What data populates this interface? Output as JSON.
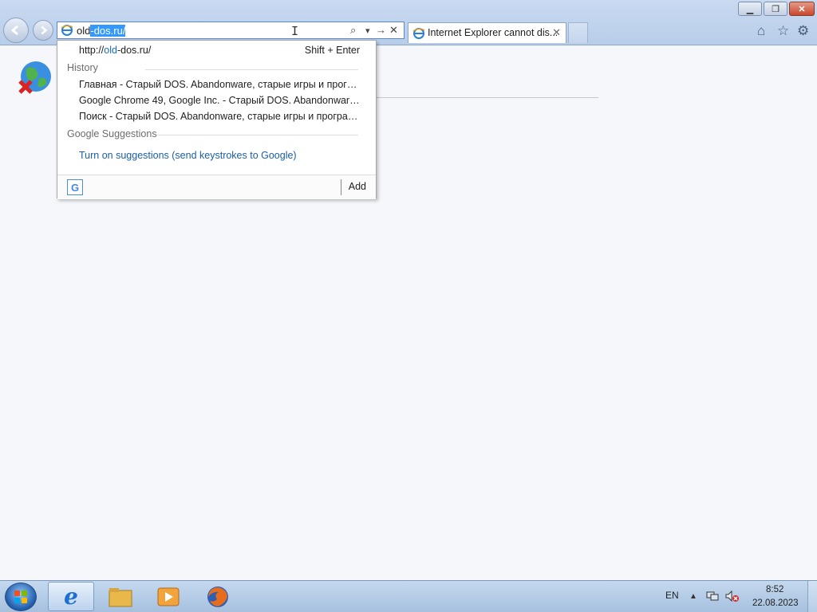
{
  "colors": {
    "accent": "#3399ff",
    "link": "#1a5fa8",
    "close_red": "#c9462b"
  },
  "window": {
    "minimize_glyph": "▁",
    "maximize_glyph": "❐",
    "close_glyph": "✕"
  },
  "address_bar": {
    "value_typed": "old",
    "value_autocomplete": "-dos.ru/",
    "search_glyph": "⌕",
    "dropdown_glyph": "▾",
    "go_glyph": "→",
    "stop_glyph": "✕"
  },
  "tab": {
    "title": "Internet Explorer cannot dis...",
    "close_glyph": "✕"
  },
  "toolbar": {
    "home_glyph": "⌂",
    "favorites_glyph": "☆",
    "tools_glyph": "⚙"
  },
  "dropdown": {
    "url_prefix": "http://",
    "url_highlight": "old",
    "url_suffix": "-dos.ru/",
    "url_hint": "Shift + Enter",
    "history_label": "History",
    "history": [
      "Главная - Старый DOS. Abandonware, старые игры и програм...",
      "Google Chrome 49, Google Inc. - Старый DOS. Abandonware, ст...",
      "Поиск - Старый DOS. Abandonware, старые игры и программ..."
    ],
    "suggestions_label": "Google Suggestions",
    "suggestions_link": "Turn on suggestions (send keystrokes to Google)",
    "search_provider_glyph": "G",
    "add_label": "Add"
  },
  "taskbar": {
    "language": "EN",
    "time": "8:52",
    "date": "22.08.2023",
    "ie_glyph": "e"
  }
}
